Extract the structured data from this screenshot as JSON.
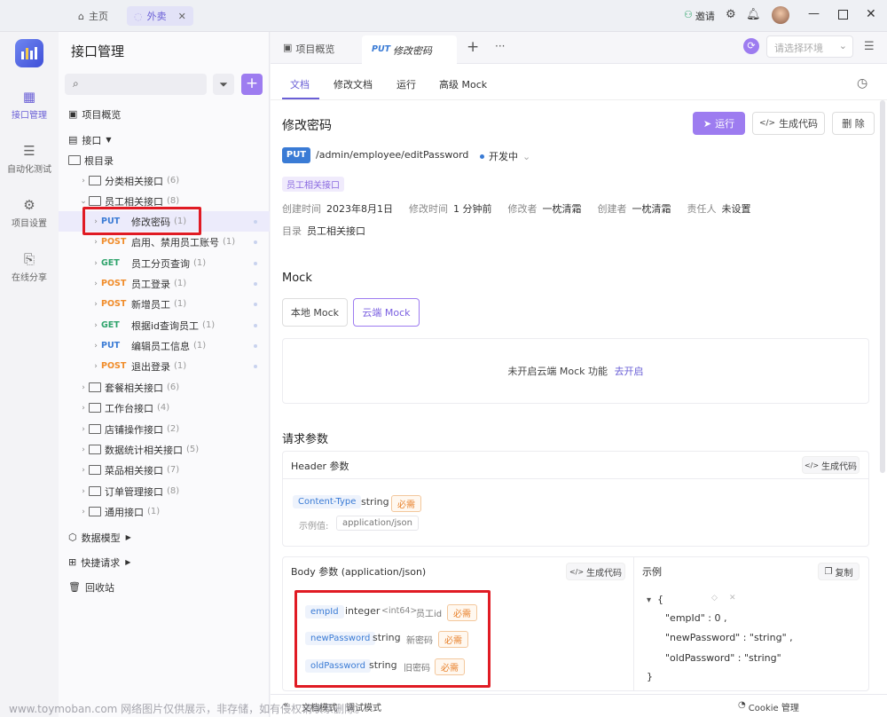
{
  "titlebar": {
    "home": "主页",
    "active_tab": "外卖",
    "invite": "邀请"
  },
  "rail": [
    {
      "label": "接口管理"
    },
    {
      "label": "自动化测试"
    },
    {
      "label": "项目设置"
    },
    {
      "label": "在线分享"
    }
  ],
  "sidebar": {
    "title": "接口管理",
    "project_overview": "项目概览",
    "api_label": "接口",
    "root": "根目录",
    "tree": [
      {
        "label": "分类相关接口",
        "count": "(6)"
      },
      {
        "label": "员工相关接口",
        "count": "(8)"
      },
      {
        "method": "PUT",
        "label": "修改密码",
        "count": "(1)"
      },
      {
        "method": "POST",
        "label": "启用、禁用员工账号",
        "count": "(1)"
      },
      {
        "method": "GET",
        "label": "员工分页查询",
        "count": "(1)"
      },
      {
        "method": "POST",
        "label": "员工登录",
        "count": "(1)"
      },
      {
        "method": "POST",
        "label": "新增员工",
        "count": "(1)"
      },
      {
        "method": "GET",
        "label": "根据id查询员工",
        "count": "(1)"
      },
      {
        "method": "PUT",
        "label": "编辑员工信息",
        "count": "(1)"
      },
      {
        "method": "POST",
        "label": "退出登录",
        "count": "(1)"
      },
      {
        "label": "套餐相关接口",
        "count": "(6)"
      },
      {
        "label": "工作台接口",
        "count": "(4)"
      },
      {
        "label": "店铺操作接口",
        "count": "(2)"
      },
      {
        "label": "数据统计相关接口",
        "count": "(5)"
      },
      {
        "label": "菜品相关接口",
        "count": "(7)"
      },
      {
        "label": "订单管理接口",
        "count": "(8)"
      },
      {
        "label": "通用接口",
        "count": "(1)"
      }
    ],
    "data_model": "数据模型",
    "quick_request": "快捷请求",
    "recycle": "回收站"
  },
  "tabs": {
    "overview": "项目概览",
    "active_method": "PUT",
    "active_name": "修改密码",
    "add": "+",
    "more": "···",
    "env_placeholder": "请选择环境"
  },
  "subtabs": [
    "文档",
    "修改文档",
    "运行",
    "高级 Mock"
  ],
  "doc": {
    "title": "修改密码",
    "run": "运行",
    "gen_code": "生成代码",
    "delete": "删 除",
    "method": "PUT",
    "path": "/admin/employee/editPassword",
    "status": "开发中",
    "folder_tag": "员工相关接口",
    "meta": [
      {
        "l": "创建时间",
        "v": "2023年8月1日"
      },
      {
        "l": "修改时间",
        "v": "1 分钟前"
      },
      {
        "l": "修改者",
        "v": "一枕清霜"
      },
      {
        "l": "创建者",
        "v": "一枕清霜"
      },
      {
        "l": "责任人",
        "v": "未设置"
      }
    ],
    "dir_label": "目录",
    "dir_value": "员工相关接口"
  },
  "mock": {
    "title": "Mock",
    "local": "本地 Mock",
    "cloud": "云端 Mock",
    "notice": "未开启云端 Mock 功能",
    "enable": "去开启"
  },
  "params": {
    "title": "请求参数",
    "header_title": "Header 参数",
    "header_gen": "生成代码",
    "header_field": {
      "name": "Content-Type",
      "type": "string",
      "required": "必需",
      "example_label": "示例值:",
      "example_value": "application/json"
    },
    "body_title": "Body 参数 (application/json)",
    "body_gen": "生成代码",
    "body_fields": [
      {
        "name": "empId",
        "type": "integer",
        "sub": "<int64>",
        "desc": "员工id",
        "required": "必需"
      },
      {
        "name": "newPassword",
        "type": "string",
        "desc": "新密码",
        "required": "必需"
      },
      {
        "name": "oldPassword",
        "type": "string",
        "desc": "旧密码",
        "required": "必需"
      }
    ],
    "example_title": "示例",
    "copy": "复制",
    "json_lines": [
      "{",
      "\"empId\" : 0 ,",
      "\"newPassword\" : \"string\" ,",
      "\"oldPassword\" : \"string\"",
      "}"
    ]
  },
  "footer": {
    "doc_mode": "文档模式",
    "debug_mode": "调试模式",
    "cookie": "Cookie 管理"
  },
  "watermark": "www.toymoban.com 网络图片仅供展示，非存储，如有侵权请联系删除。"
}
